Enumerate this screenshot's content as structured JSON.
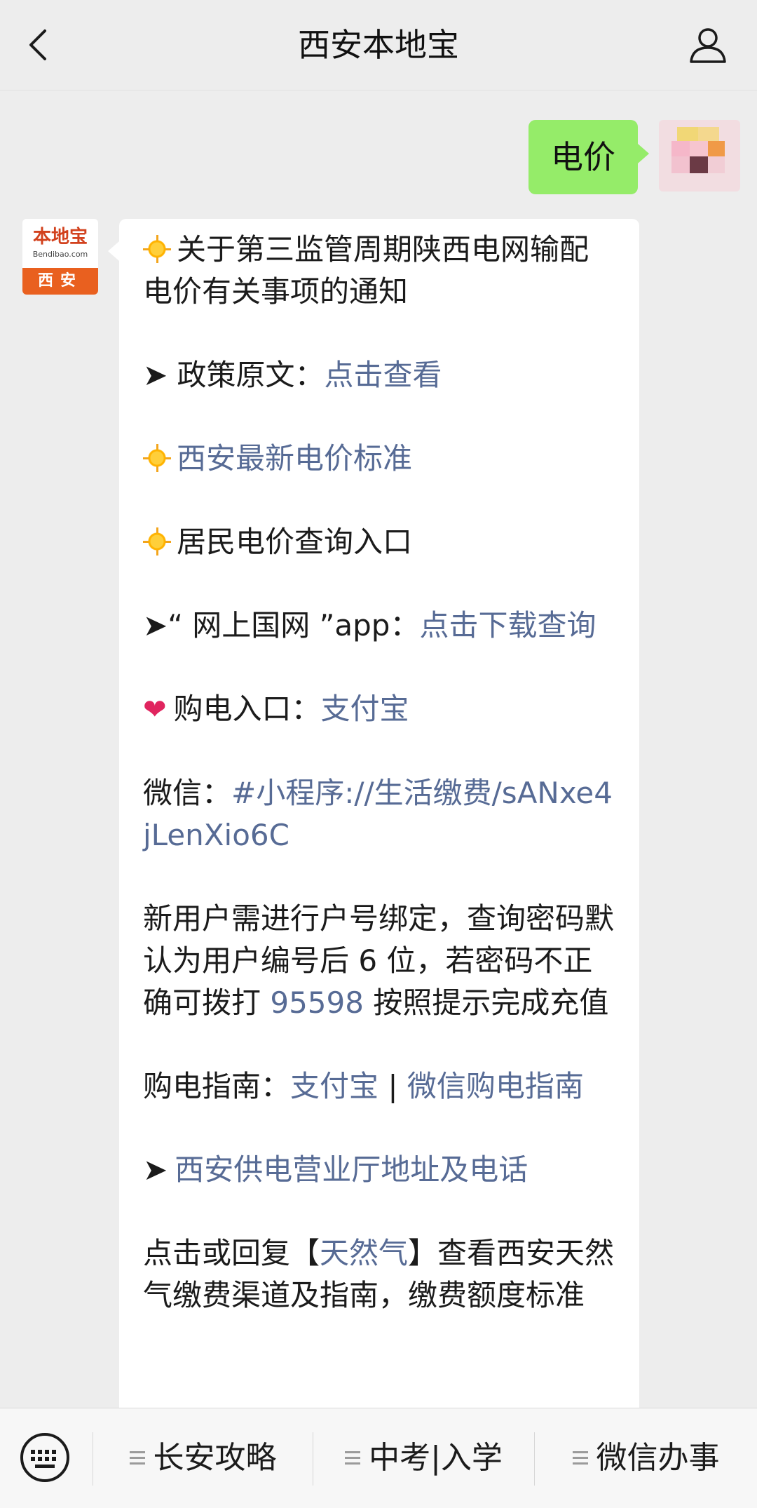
{
  "header": {
    "title": "西安本地宝",
    "back_icon": "chevron-left-icon",
    "profile_icon": "user-icon"
  },
  "user_message": {
    "text": "电价"
  },
  "bot_avatar": {
    "brand": "本地宝",
    "site": "Bendibao.com",
    "city": "西安"
  },
  "bot_message": {
    "title": "关于第三监管周期陕西电网输配电价有关事项的通知",
    "policy_label": "➤ 政策原文：",
    "policy_link": "点击查看",
    "price_standard_link": "西安最新电价标准",
    "residential_query": "居民电价查询入口",
    "app_prefix": "➤“ 网上国网 ”app：",
    "app_link": "点击下载查询",
    "purchase_label": "购电入口：",
    "alipay_link": "支付宝",
    "wechat_label": "微信：",
    "wechat_link": "#小程序://生活缴费/sANxe4jLenXio6C",
    "binding_pre": "新用户需进行户号绑定，查询密码默认为用户编号后 6 位，若密码不正确可拨打 ",
    "hotline": "95598",
    "binding_post": " 按照提示完成充值",
    "guide_label": "购电指南：",
    "guide_alipay": "支付宝",
    "guide_sep": " | ",
    "guide_wechat": "微信购电指南",
    "service_hall_link": "西安供电营业厅地址及电话",
    "gas_pre": "点击或回复【",
    "gas_link": "天然气",
    "gas_post": "】查看西安天然气缴费渠道及指南，缴费额度标准"
  },
  "bottom_menu": {
    "keyboard_icon": "keyboard-icon",
    "items": [
      {
        "label": "长安攻略"
      },
      {
        "label": "中考|入学"
      },
      {
        "label": "微信办事"
      }
    ]
  },
  "colors": {
    "background": "#ededed",
    "user_bubble": "#95ec69",
    "link": "#576b95",
    "bubble": "#ffffff"
  }
}
